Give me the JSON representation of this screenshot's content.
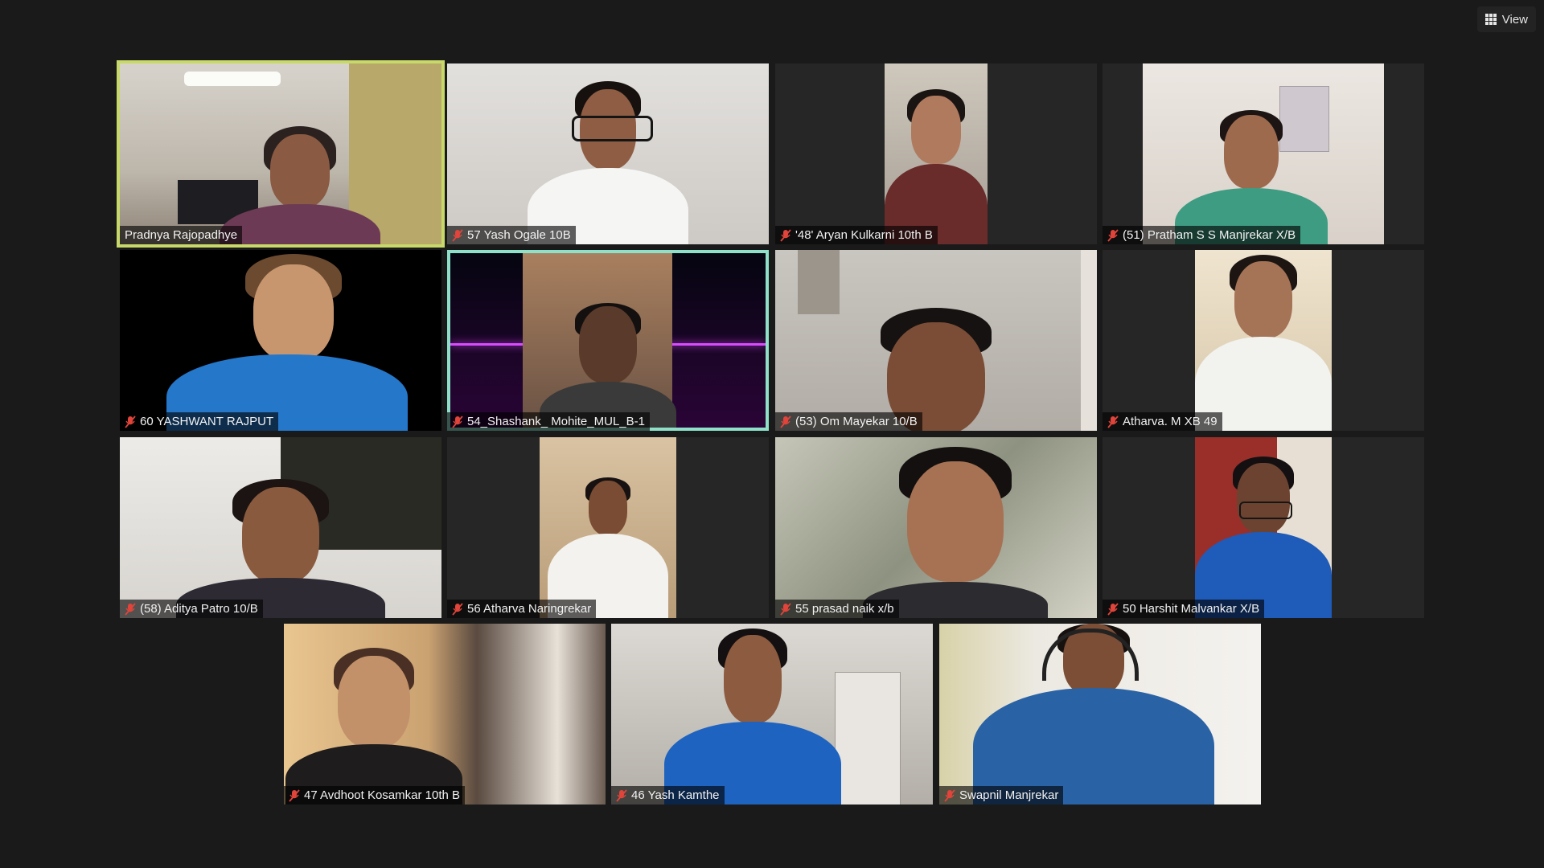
{
  "header": {
    "view_label": "View"
  },
  "participants": [
    {
      "name": "Pradnya Rajopadhye",
      "muted": false
    },
    {
      "name": "57 Yash Ogale 10B",
      "muted": true
    },
    {
      "name": "'48' Aryan Kulkarni 10th B",
      "muted": true
    },
    {
      "name": "(51) Pratham S S Manjrekar X/B",
      "muted": true
    },
    {
      "name": "60 YASHWANT RAJPUT",
      "muted": true
    },
    {
      "name": "54_Shashank_ Mohite_MUL_B-1",
      "muted": true
    },
    {
      "name": "(53) Om Mayekar 10/B",
      "muted": true
    },
    {
      "name": "Atharva. M XB 49",
      "muted": true
    },
    {
      "name": "(58) Aditya Patro 10/B",
      "muted": true
    },
    {
      "name": "56 Atharva Naringrekar",
      "muted": true
    },
    {
      "name": "55 prasad naik x/b",
      "muted": true
    },
    {
      "name": "50 Harshit Malvankar X/B",
      "muted": true
    },
    {
      "name": "47 Avdhoot Kosamkar 10th B",
      "muted": true
    },
    {
      "name": "46 Yash Kamthe",
      "muted": true
    },
    {
      "name": "Swapnil Manjrekar",
      "muted": true
    }
  ],
  "icons": {
    "muted": "mic-muted-icon",
    "view": "grid-view-icon"
  },
  "colors": {
    "background": "#1a1a1a",
    "active_speaker_border": "#c8d86a",
    "muted_icon": "#e0443a"
  }
}
